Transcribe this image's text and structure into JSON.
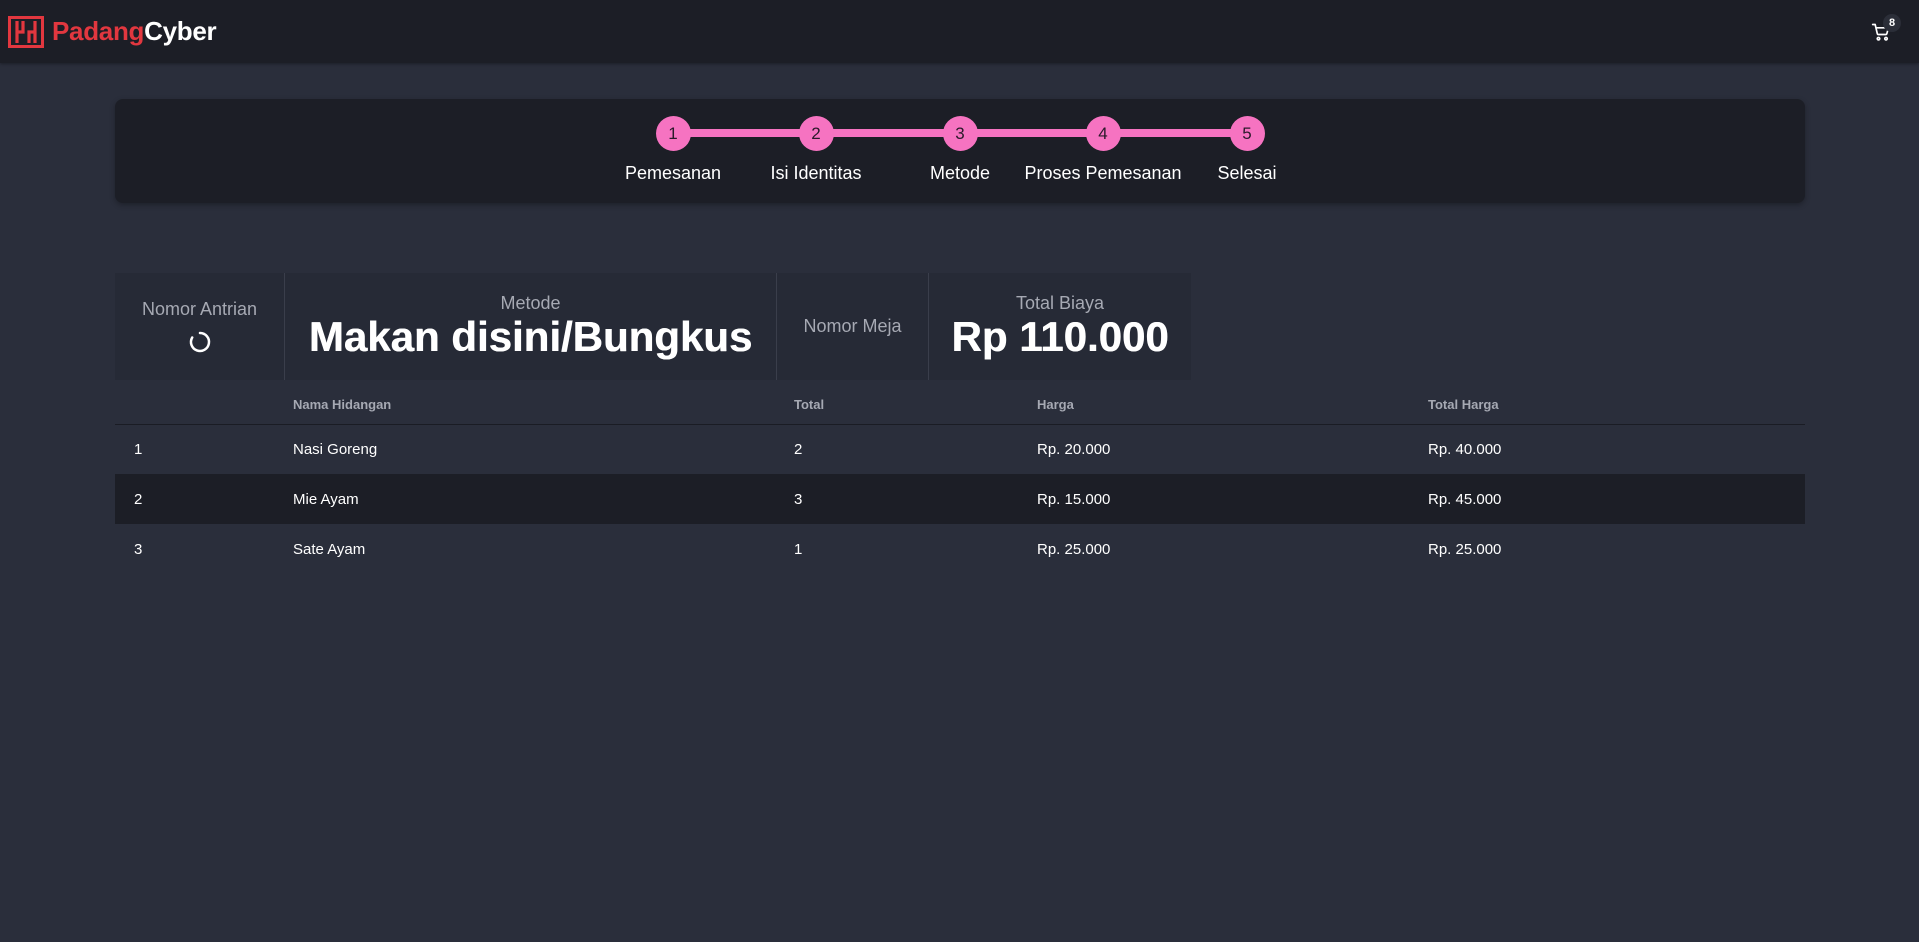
{
  "navbar": {
    "brand_part1": "Padang",
    "brand_part2": "Cyber",
    "cart_icon": "cart-icon",
    "cart_count": "8",
    "colors": {
      "brand_red": "#e2373f",
      "background": "#1c1e26"
    }
  },
  "steps": {
    "accent_color": "#f673c1",
    "items": [
      {
        "number": "1",
        "label": "Pemesanan"
      },
      {
        "number": "2",
        "label": "Isi Identitas"
      },
      {
        "number": "3",
        "label": "Metode"
      },
      {
        "number": "4",
        "label": "Proses Pemesanan"
      },
      {
        "number": "5",
        "label": "Selesai"
      }
    ]
  },
  "stats": {
    "queue": {
      "title": "Nomor Antrian",
      "value_icon": "loading-spinner-icon"
    },
    "method": {
      "title": "Metode",
      "value": "Makan disini/Bungkus"
    },
    "table_number": {
      "title": "Nomor Meja",
      "value": ""
    },
    "total": {
      "title": "Total Biaya",
      "value": "Rp 110.000"
    }
  },
  "order_table": {
    "headers": [
      "",
      "Nama Hidangan",
      "Total",
      "Harga",
      "Total Harga"
    ],
    "rows": [
      {
        "no": "1",
        "name": "Nasi Goreng",
        "qty": "2",
        "price": "Rp. 20.000",
        "subtotal": "Rp. 40.000"
      },
      {
        "no": "2",
        "name": "Mie Ayam",
        "qty": "3",
        "price": "Rp. 15.000",
        "subtotal": "Rp. 45.000"
      },
      {
        "no": "3",
        "name": "Sate Ayam",
        "qty": "1",
        "price": "Rp. 25.000",
        "subtotal": "Rp. 25.000"
      }
    ]
  }
}
